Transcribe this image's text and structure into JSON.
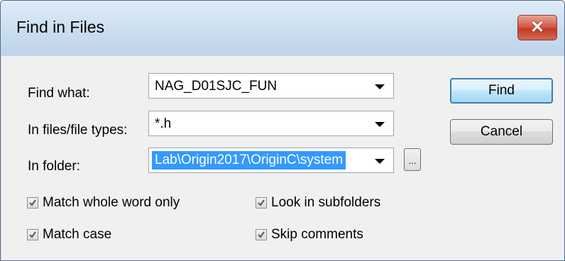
{
  "dialog": {
    "title": "Find in Files",
    "close_glyph": "✕"
  },
  "fields": {
    "find_what": {
      "label": "Find what:",
      "value": "NAG_D01SJC_FUN"
    },
    "file_types": {
      "label": "In files/file types:",
      "value": "*.h"
    },
    "folder": {
      "label": "In folder:",
      "value": "Lab\\Origin2017\\OriginC\\system"
    }
  },
  "buttons": {
    "find": "Find",
    "cancel": "Cancel",
    "browse": "..."
  },
  "options": {
    "match_whole_word": {
      "label": "Match whole word only",
      "checked": true
    },
    "match_case": {
      "label": "Match case",
      "checked": true
    },
    "look_in_subfolders": {
      "label": "Look in subfolders",
      "checked": true
    },
    "skip_comments": {
      "label": "Skip comments",
      "checked": true
    }
  },
  "icons": {
    "close": "close-icon",
    "dropdown": "chevron-down-icon",
    "check": "checkmark-icon"
  },
  "colors": {
    "selection": "#3399ff",
    "close_button": "#c33a25",
    "titlebar": "#c9dcee"
  }
}
